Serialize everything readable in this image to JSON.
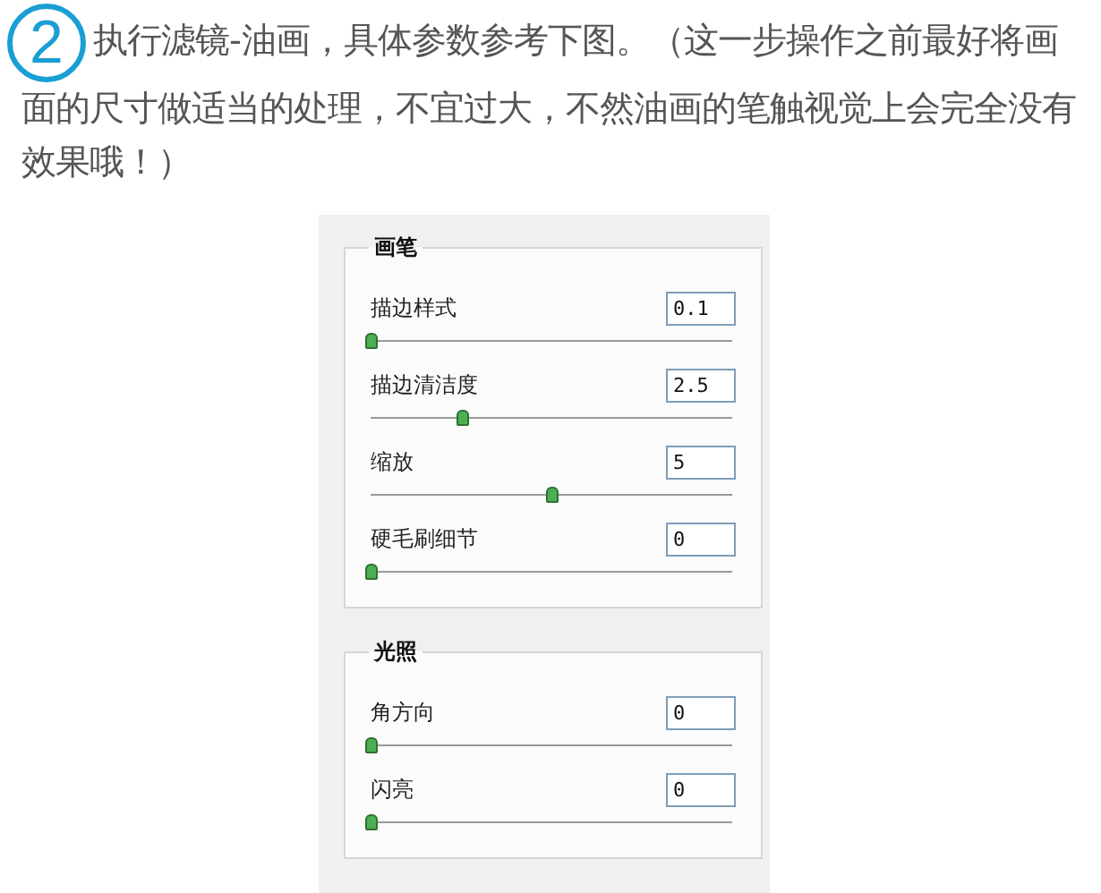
{
  "step": {
    "number": "2",
    "text": "执行滤镜-油画，具体参数参考下图。（这一步操作之前最好将画面的尺寸做适当的处理，不宜过大，不然油画的笔触视觉上会完全没有效果哦！）"
  },
  "dialog": {
    "groups": [
      {
        "title": "画笔",
        "controls": [
          {
            "label": "描边样式",
            "value": "0.1",
            "level": 0
          },
          {
            "label": "描边清洁度",
            "value": "2.5",
            "level": 0.25
          },
          {
            "label": "缩放",
            "value": "5",
            "level": 0.5
          },
          {
            "label": "硬毛刷细节",
            "value": "0",
            "level": 0
          }
        ]
      },
      {
        "title": "光照",
        "controls": [
          {
            "label": "角方向",
            "value": "0",
            "level": 0
          },
          {
            "label": "闪亮",
            "value": "0",
            "level": 0
          }
        ]
      }
    ]
  }
}
